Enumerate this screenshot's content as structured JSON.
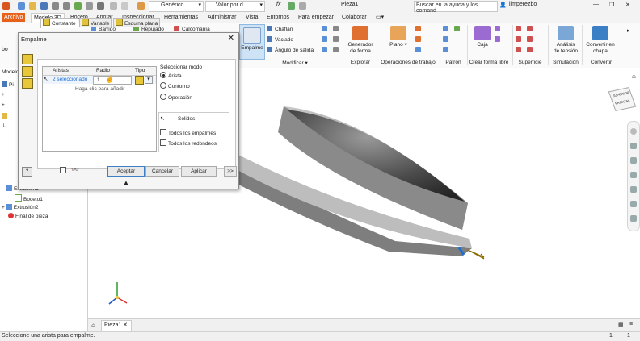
{
  "titlebar": {
    "appearance_value": "Genérico",
    "material_value": "Valor por d",
    "document_title": "Pieza1",
    "search_placeholder": "Buscar en la ayuda y los comand",
    "user": "limperezbo"
  },
  "ribbon_tabs": [
    "Archivo",
    "Modelo 3D",
    "Boceto",
    "Anotar",
    "Inspeccionar",
    "Herramientas",
    "Administrar",
    "Vista",
    "Entornos",
    "Para empezar",
    "Colaborar"
  ],
  "ribbon": {
    "left_small": [
      "Barrido",
      "Repujado",
      "Calcomanía"
    ],
    "empalme": "Empalme",
    "modify_small": [
      "Chaflán",
      "Vaciado",
      "Ángulo de salida"
    ],
    "modify_group": "Modificar",
    "generador_line1": "Generador",
    "generador_line2": "de forma",
    "explorar_group": "Explorar",
    "plano": "Plano",
    "operaciones_group": "Operaciones de trabajo",
    "patron_group": "Patrón",
    "caja": "Caja",
    "forma_libre_group": "Crear forma libre",
    "superficie_group": "Superficie",
    "analisis_line1": "Análisis",
    "analisis_line2": "de tensión",
    "simulacion_group": "Simulación",
    "convertir_line1": "Convertir en",
    "convertir_line2": "chapa",
    "convertir_group": "Convertir"
  },
  "browser": {
    "header": "Modelo",
    "root_partial": "Pi",
    "left_partial": "bo",
    "items": [
      {
        "label": "Extrusión1"
      },
      {
        "label": "Boceto1"
      },
      {
        "label": "Extrusión2"
      },
      {
        "label": "Final de pieza"
      }
    ]
  },
  "dialog": {
    "title": "Empalme",
    "tabs": [
      "Constante",
      "Variable",
      "Esquina plana"
    ],
    "columns": [
      "Aristas",
      "Radio",
      "Tipo"
    ],
    "row": {
      "edges": "2 seleccionado",
      "radius": "1"
    },
    "add_hint": "Haga clic para añadir",
    "select_mode_label": "Seleccionar modo",
    "modes": [
      "Arista",
      "Contorno",
      "Operación"
    ],
    "selected_mode": "Arista",
    "solids_label": "Sólidos",
    "checks": [
      "Todos los empalmes",
      "Todos los redondeos"
    ],
    "buttons": {
      "ok": "Aceptar",
      "cancel": "Cancelar",
      "apply": "Aplicar",
      "more": ">>"
    }
  },
  "viewcube": {
    "top": "SUPERIOR",
    "front": "FRONTAL"
  },
  "doc_tab": "Pieza1",
  "status": {
    "text": "Seleccione una arista para empalme.",
    "num1": "1",
    "num2": "1"
  },
  "colors": {
    "file_tab": "#e8611a",
    "selection_blue": "#1f6fd1",
    "part_gray": "#8f8f8f"
  }
}
